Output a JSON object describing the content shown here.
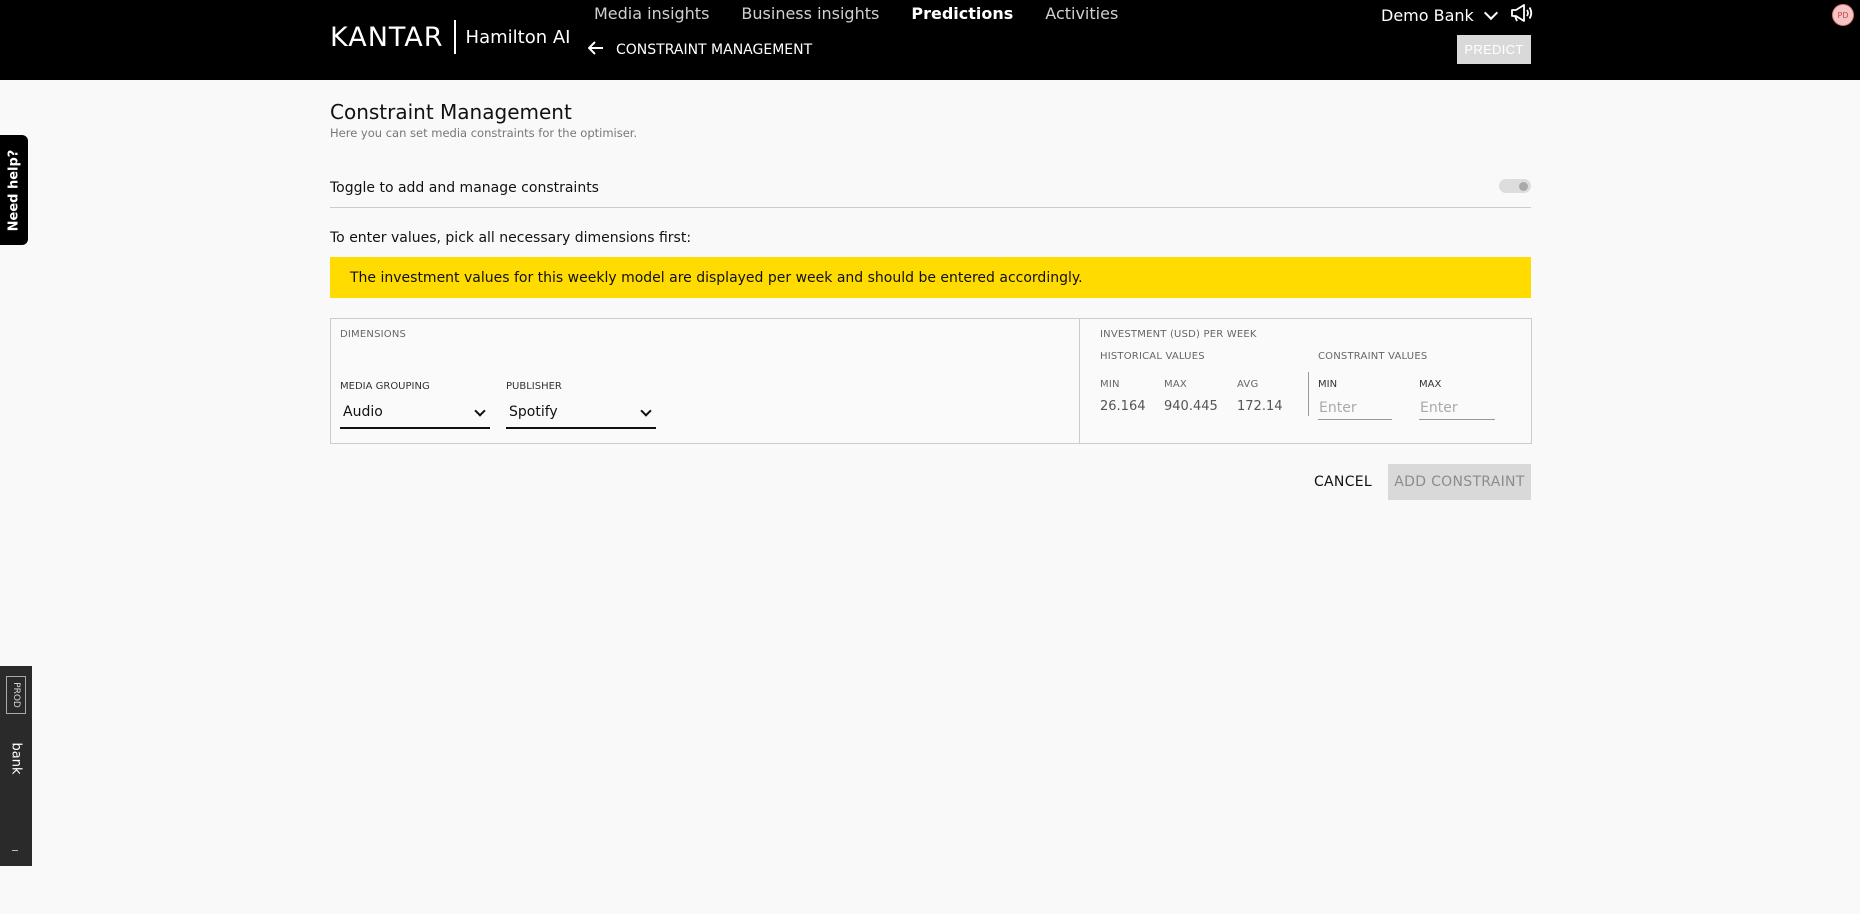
{
  "header": {
    "brand_logo": "KANTAR",
    "brand_product": "Hamilton AI",
    "nav": [
      {
        "label": "Media insights",
        "active": false
      },
      {
        "label": "Business insights",
        "active": false
      },
      {
        "label": "Predictions",
        "active": true
      },
      {
        "label": "Activities",
        "active": false
      }
    ],
    "subnav_label": "CONSTRAINT MANAGEMENT",
    "account_name": "Demo Bank",
    "avatar_initials": "PD",
    "predict_label": "PREDICT"
  },
  "side": {
    "help_label": "Need help?",
    "env_badge": "PROD",
    "env_name": "bank"
  },
  "page": {
    "title": "Constraint Management",
    "subtitle": "Here you can set media constraints for the optimiser.",
    "toggle_label": "Toggle to add and manage constraints",
    "toggle_on": false,
    "instructions": "To enter values, pick all necessary dimensions first:",
    "banner": "The investment values for this weekly model are displayed per week and should be entered accordingly."
  },
  "dimensions": {
    "heading": "DIMENSIONS",
    "media_grouping": {
      "label": "MEDIA GROUPING",
      "value": "Audio"
    },
    "publisher": {
      "label": "PUBLISHER",
      "value": "Spotify"
    }
  },
  "investment": {
    "heading": "INVESTMENT (USD) PER WEEK",
    "historical_heading": "HISTORICAL VALUES",
    "constraint_heading": "CONSTRAINT VALUES",
    "historical": {
      "min_label": "MIN",
      "min": "26.164",
      "max_label": "MAX",
      "max": "940.445",
      "avg_label": "AVG",
      "avg": "172.14"
    },
    "constraint": {
      "min_label": "MIN",
      "min_placeholder": "Enter",
      "min_value": "",
      "max_label": "MAX",
      "max_placeholder": "Enter",
      "max_value": ""
    }
  },
  "actions": {
    "cancel_label": "CANCEL",
    "add_label": "ADD CONSTRAINT"
  },
  "colors": {
    "header_bg": "#000000",
    "banner_bg": "#ffdb00",
    "disabled_btn": "#d9d9d9"
  }
}
